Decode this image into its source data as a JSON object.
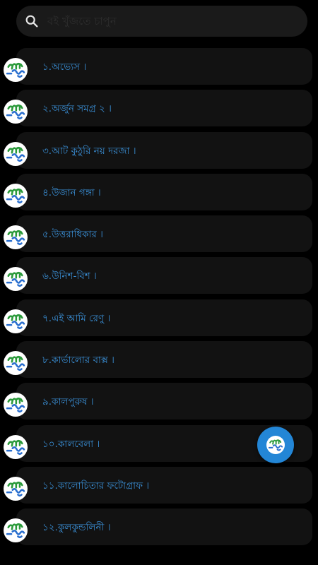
{
  "search": {
    "placeholder": "বই খুঁজতে চাপুন",
    "icon": "search-icon"
  },
  "logo": {
    "icon": "boi-ting-logo-icon",
    "lettering": "বই-টিং",
    "colors": {
      "top": "#2a9a3a",
      "bottom": "#2a6fcf",
      "background": "#ffffff"
    }
  },
  "theme": {
    "background": "#000000",
    "card": "#121212",
    "search_bar": "#1a1a1a",
    "title_color": "#3a8fd6",
    "fab_color": "#2386d6"
  },
  "books": [
    {
      "title": "১.অভ্যেস ।"
    },
    {
      "title": "২.অর্জুন সমগ্র ২ ।"
    },
    {
      "title": "৩.আট কুঠুরি নয় দরজা ।"
    },
    {
      "title": "৪.উজান গঙ্গা ।"
    },
    {
      "title": "৫.উত্তরাধিকার ।"
    },
    {
      "title": "৬.উনিশ-বিশ ।"
    },
    {
      "title": "৭.এই আমি রেণু ।"
    },
    {
      "title": "৮.কার্ভালোর বাক্স ।"
    },
    {
      "title": "৯.কালপুরুষ ।"
    },
    {
      "title": "১০.কালবেলা ।"
    },
    {
      "title": "১১.কালোচিতার ফটোগ্রাফ ।"
    },
    {
      "title": "১২.কুলকুন্ডলিনী ।"
    }
  ],
  "fab": {
    "icon": "boi-ting-logo-icon"
  }
}
